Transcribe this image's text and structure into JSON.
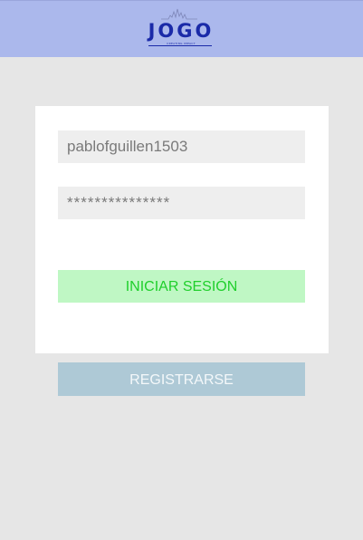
{
  "header": {
    "logo": {
      "name": "JOGO",
      "tagline": "CREATING IMPACT"
    }
  },
  "login_form": {
    "username_value": "pablofguillen1503",
    "password_value": "***************",
    "login_label": "INICIAR SESIÓN"
  },
  "register_label": "REGISTRARSE",
  "colors": {
    "header_bg": "#abb8ec",
    "logo": "#1a2aa8",
    "login_bg": "#bff7c4",
    "login_text": "#1fcf2b",
    "register_bg": "#aec9d6",
    "page_bg": "#e6e6e6"
  }
}
